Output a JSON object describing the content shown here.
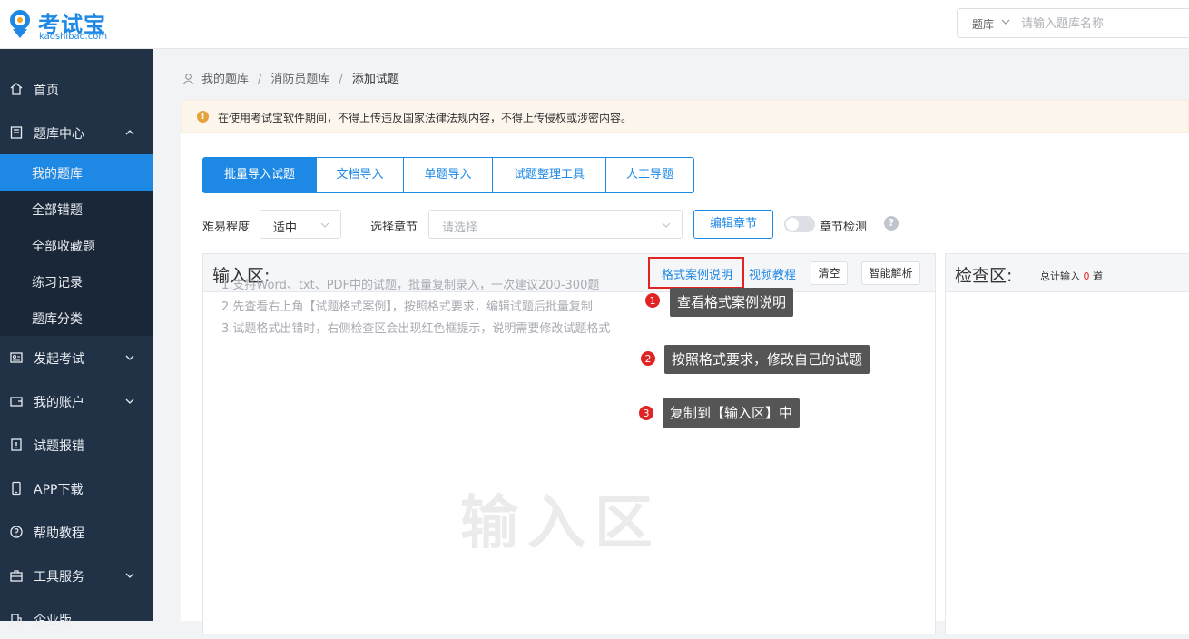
{
  "header": {
    "logo_word": "考试宝",
    "logo_sub": "kaoshibao.com",
    "search_category": "题库",
    "search_placeholder": "请输入题库名称"
  },
  "sidebar": {
    "items": [
      {
        "label": "首页",
        "icon": "home-icon"
      },
      {
        "label": "题库中心",
        "icon": "book-icon"
      },
      {
        "label": "发起考试",
        "icon": "exam-icon"
      },
      {
        "label": "我的账户",
        "icon": "wallet-icon"
      },
      {
        "label": "试题报错",
        "icon": "report-icon"
      },
      {
        "label": "APP下载",
        "icon": "phone-icon"
      },
      {
        "label": "帮助教程",
        "icon": "help-icon"
      },
      {
        "label": "工具服务",
        "icon": "toolbox-icon"
      },
      {
        "label": "企业版",
        "icon": "building-icon"
      }
    ],
    "sub_items": [
      {
        "label": "我的题库",
        "active": true
      },
      {
        "label": "全部错题"
      },
      {
        "label": "全部收藏题"
      },
      {
        "label": "练习记录"
      },
      {
        "label": "题库分类"
      }
    ]
  },
  "breadcrumb": {
    "items": [
      "我的题库",
      "消防员题库",
      "添加试题"
    ],
    "separator": "/"
  },
  "notice": {
    "text": "在使用考试宝软件期间，不得上传违反国家法律法规内容，不得上传侵权或涉密内容。",
    "icon": "!"
  },
  "tabs": [
    "批量导入试题",
    "文档导入",
    "单题导入",
    "试题整理工具",
    "人工导题"
  ],
  "filters": {
    "difficulty_label": "难易程度",
    "difficulty_value": "适中",
    "chapter_label": "选择章节",
    "chapter_placeholder": "请选择",
    "edit_chapter": "编辑章节",
    "chapter_check": "章节检测",
    "help": "?"
  },
  "input_area": {
    "title": "输入区:",
    "format_link": "格式案例说明",
    "video_link": "视频教程",
    "clear": "清空",
    "smart_parse": "智能解析",
    "hints": [
      "1.支持Word、txt、PDF中的试题，批量复制录入，一次建议200-300题",
      "2.先查看右上角【试题格式案例】，按照格式要求，编辑试题后批量复制",
      "3.试题格式出错时，右侧检查区会出现红色框提示，说明需要修改试题格式"
    ],
    "watermark": "输入区"
  },
  "check_area": {
    "title": "检查区:",
    "total_label": "总计输入",
    "total_count": "0",
    "total_unit": "道"
  },
  "callouts": [
    {
      "num": "1",
      "text": "查看格式案例说明"
    },
    {
      "num": "2",
      "text": "按照格式要求，修改自己的试题"
    },
    {
      "num": "3",
      "text": "复制到【输入区】中"
    }
  ],
  "colors": {
    "primary": "#1e88e5",
    "sidebar_bg": "#223246",
    "warning": "#e6a23c",
    "danger": "#e02424"
  }
}
